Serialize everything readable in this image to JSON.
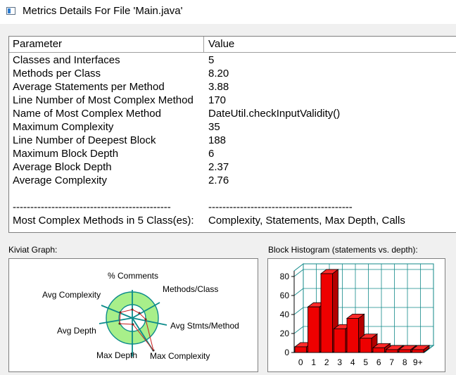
{
  "window": {
    "title": "Metrics Details For File 'Main.java'"
  },
  "table": {
    "headers": {
      "parameter": "Parameter",
      "value": "Value"
    },
    "rows": [
      {
        "parameter": "Classes and Interfaces",
        "value": "5"
      },
      {
        "parameter": "Methods per Class",
        "value": "8.20"
      },
      {
        "parameter": "Average Statements per Method",
        "value": "3.88"
      },
      {
        "parameter": "Line Number of Most Complex Method",
        "value": "170"
      },
      {
        "parameter": "Name of Most Complex Method",
        "value": "DateUtil.checkInputValidity()"
      },
      {
        "parameter": "Maximum Complexity",
        "value": "35"
      },
      {
        "parameter": "Line Number of Deepest Block",
        "value": "188"
      },
      {
        "parameter": "Maximum Block Depth",
        "value": "6"
      },
      {
        "parameter": "Average Block Depth",
        "value": "2.37"
      },
      {
        "parameter": "Average Complexity",
        "value": "2.76"
      },
      {
        "parameter": "",
        "value": ""
      },
      {
        "parameter": "---------------------------------------------",
        "value": "-----------------------------------------"
      },
      {
        "parameter": "Most Complex Methods in 5 Class(es):",
        "value": "Complexity, Statements, Max Depth, Calls"
      }
    ]
  },
  "kiviat": {
    "label": "Kiviat Graph:",
    "axes": {
      "comments": "% Comments",
      "methods_per_class": "Methods/Class",
      "avg_stmts": "Avg Stmts/Method",
      "max_complexity": "Max Complexity",
      "max_depth": "Max Depth",
      "avg_depth": "Avg Depth",
      "avg_complexity": "Avg Complexity"
    },
    "colors": {
      "ring": "#a8ef8a",
      "spoke": "#0c8b8b",
      "profile": "#c81e1e"
    }
  },
  "histogram": {
    "label": "Block Histogram (statements vs. depth):",
    "colors": {
      "bar": "#ee0000",
      "grid": "#138a8a",
      "floor": "#a9d8d8"
    }
  },
  "chart_data": {
    "type": "bar",
    "categories": [
      "0",
      "1",
      "2",
      "3",
      "4",
      "5",
      "6",
      "7",
      "8",
      "9+"
    ],
    "values": [
      6,
      48,
      83,
      25,
      36,
      15,
      5,
      3,
      3,
      3
    ],
    "ylim": [
      0,
      80
    ],
    "yticks": [
      "0",
      "20",
      "40",
      "60",
      "80"
    ],
    "grid": true
  }
}
